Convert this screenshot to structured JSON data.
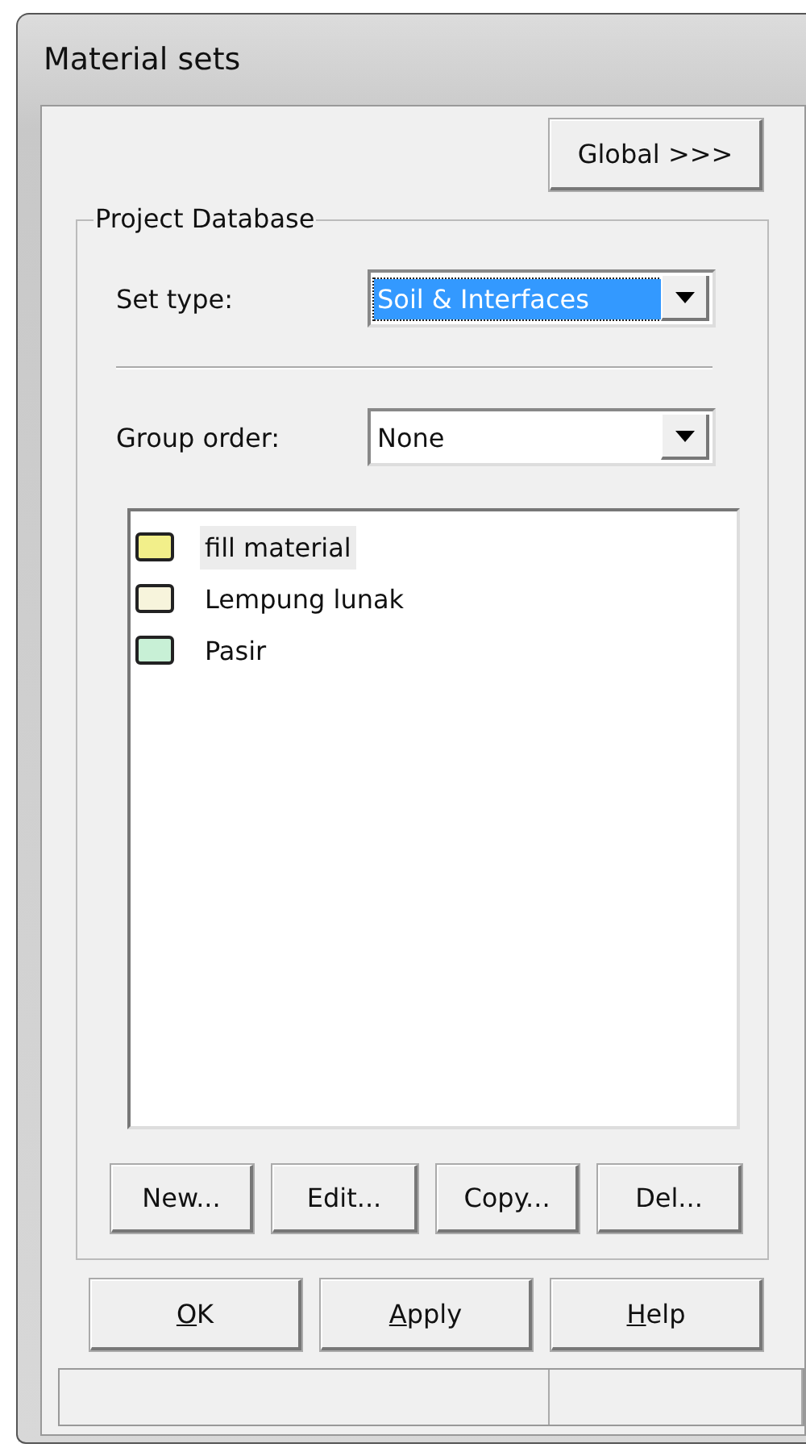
{
  "window": {
    "title": "Material sets"
  },
  "global_button": "Global >>>",
  "group": {
    "title": "Project Database",
    "set_type": {
      "label": "Set type:",
      "value": "Soil & Interfaces",
      "focused": true
    },
    "group_order": {
      "label": "Group order:",
      "value": "None",
      "focused": false
    },
    "materials": [
      {
        "name": "fill material",
        "color": "#f2ef8a",
        "selected": true
      },
      {
        "name": "Lempung lunak",
        "color": "#f7f4dc",
        "selected": false
      },
      {
        "name": "Pasir",
        "color": "#c8f0d6",
        "selected": false
      }
    ],
    "buttons": [
      "New...",
      "Edit...",
      "Copy...",
      "Del..."
    ]
  },
  "dialog_buttons": [
    {
      "label": "OK"
    },
    {
      "label": "Apply"
    },
    {
      "label": "Help"
    }
  ]
}
